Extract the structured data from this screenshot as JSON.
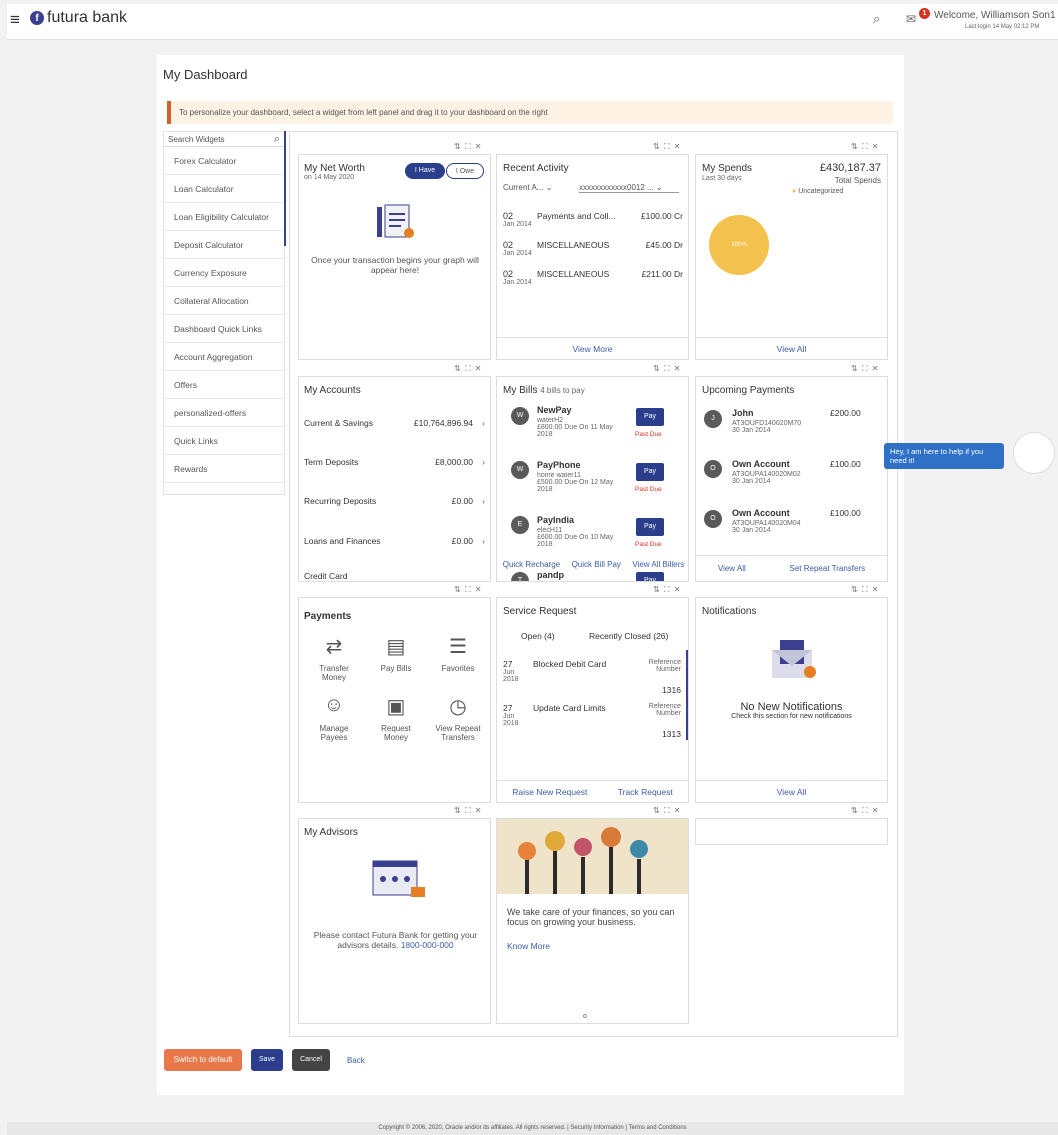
{
  "header": {
    "brand": "futura bank",
    "logo_letter": "f",
    "welcome": "Welcome, Williamson Son1",
    "last_login": "Last login 14 May 02:12 PM",
    "mail_count": "1"
  },
  "page_title": "My Dashboard",
  "banner": "To personalize your dashboard, select a widget from left panel and drag it to your dashboard on the right",
  "sidebar": {
    "search_placeholder": "Search Widgets",
    "items": [
      {
        "label": "Forex Calculator"
      },
      {
        "label": "Loan Calculator"
      },
      {
        "label": "Loan Eligibility Calculator"
      },
      {
        "label": "Deposit Calculator"
      },
      {
        "label": "Currency Exposure"
      },
      {
        "label": "Collateral Allocation"
      },
      {
        "label": "Dashboard Quick Links"
      },
      {
        "label": "Account Aggregation"
      },
      {
        "label": "Offers"
      },
      {
        "label": "personalized-offers"
      },
      {
        "label": "Quick Links"
      },
      {
        "label": "Rewards"
      }
    ]
  },
  "widgets": {
    "net_worth": {
      "title": "My Net Worth",
      "date": "on 14 May 2020",
      "tab_have": "I Have",
      "tab_owe": "I Owe",
      "message": "Once your transaction begins your graph will appear here!"
    },
    "recent_activity": {
      "title": "Recent Activity",
      "account_type": "Current A...",
      "account_no": "xxxxxxxxxxxx0012 ...",
      "more": "View More",
      "rows": [
        {
          "day": "02",
          "mon": "Jan 2014",
          "desc": "Payments and Coll...",
          "amt": "£100.00 Cr"
        },
        {
          "day": "02",
          "mon": "Jan 2014",
          "desc": "MISCELLANEOUS",
          "amt": "£45.00 Dr"
        },
        {
          "day": "02",
          "mon": "Jan 2014",
          "desc": "MISCELLANEOUS",
          "amt": "£211.00 Dr"
        }
      ]
    },
    "spends": {
      "title": "My Spends",
      "period": "Last 30 days",
      "total": "£430,187.37",
      "total_label": "Total Spends",
      "legend": "Uncategorized",
      "pct": "100%",
      "view_all": "View All",
      "pie_color": "#f2c14e"
    },
    "accounts": {
      "title": "My Accounts",
      "rows": [
        {
          "label": "Current & Savings",
          "amt": "£10,764,896.94"
        },
        {
          "label": "Term Deposits",
          "amt": "£8,000.00"
        },
        {
          "label": "Recurring Deposits",
          "amt": "£0.00"
        },
        {
          "label": "Loans and Finances",
          "amt": "£0.00"
        },
        {
          "label": "Credit Card",
          "amt": ""
        }
      ]
    },
    "bills": {
      "title": "My Bills",
      "subtitle": "4 bills to pay",
      "pay": "Pay",
      "past_due": "Past Due",
      "rows": [
        {
          "initial": "W",
          "name": "NewPay",
          "sub": "waterH2",
          "due": "£800.00 Due On 11 May 2018"
        },
        {
          "initial": "W",
          "name": "PayPhone",
          "sub": "home water11",
          "due": "£500.00 Due On 12 May 2018"
        },
        {
          "initial": "E",
          "name": "PayIndia",
          "sub": "elecH11",
          "due": "£600.00 Due On 10 May 2018"
        },
        {
          "initial": "T",
          "name": "pandp"
        }
      ],
      "links": [
        "Quick Recharge",
        "Quick Bill Pay",
        "View All Billers"
      ]
    },
    "upcoming": {
      "title": "Upcoming Payments",
      "view_all": "View All",
      "repeat": "Set Repeat Transfers",
      "rows": [
        {
          "initial": "J",
          "name": "John",
          "ref": "AT3OUFD140020M70",
          "date": "30 Jan 2014",
          "amt": "£200.00"
        },
        {
          "initial": "O",
          "name": "Own Account",
          "ref": "AT3OUPA140020M02",
          "date": "30 Jan 2014",
          "amt": "£100.00"
        },
        {
          "initial": "O",
          "name": "Own Account",
          "ref": "AT3OUPA140020M04",
          "date": "30 Jan 2014",
          "amt": "£100.00"
        }
      ]
    },
    "payments": {
      "title": "Payments",
      "items": [
        {
          "label": "Transfer Money",
          "icon": "transfer-icon"
        },
        {
          "label": "Pay Bills",
          "icon": "bill-icon"
        },
        {
          "label": "Favorites",
          "icon": "favorites-icon"
        },
        {
          "label": "Manage Payees",
          "icon": "payee-icon"
        },
        {
          "label": "Request Money",
          "icon": "request-icon"
        },
        {
          "label": "View Repeat Transfers",
          "icon": "repeat-icon"
        }
      ]
    },
    "service": {
      "title": "Service Request",
      "tab_open": "Open (4)",
      "tab_closed": "Recently Closed (26)",
      "raise": "Raise New Request",
      "track": "Track Request",
      "ref_label": "Reference Number",
      "rows": [
        {
          "day": "27",
          "mon": "Jun",
          "year": "2018",
          "desc": "Blocked Debit Card",
          "ref": "1316"
        },
        {
          "day": "27",
          "mon": "Jun",
          "year": "2018",
          "desc": "Update Card Limits",
          "ref": "1313"
        }
      ]
    },
    "notifications": {
      "title": "Notifications",
      "message": "No New Notifications",
      "sub": "Check this section for new notifications",
      "view_all": "View All"
    },
    "advisors": {
      "title": "My Advisors",
      "message": "Please contact Futura Bank for getting your advisors details.",
      "phone": "1800-000-000"
    },
    "promo": {
      "text": "We take care of your finances, so you can focus on growing your business.",
      "link": "Know More"
    }
  },
  "actions": {
    "switch_default": "Switch to default",
    "save": "Save",
    "cancel": "Cancel",
    "back": "Back"
  },
  "chat": {
    "text": "Hey, I am here to help if you need it!"
  },
  "footer": "Copyright © 2006, 2020, Oracle and/or its affiliates. All rights reserved. | Security Information | Terms and Conditions",
  "widget_controls": "⇅ ⛶ ✕"
}
